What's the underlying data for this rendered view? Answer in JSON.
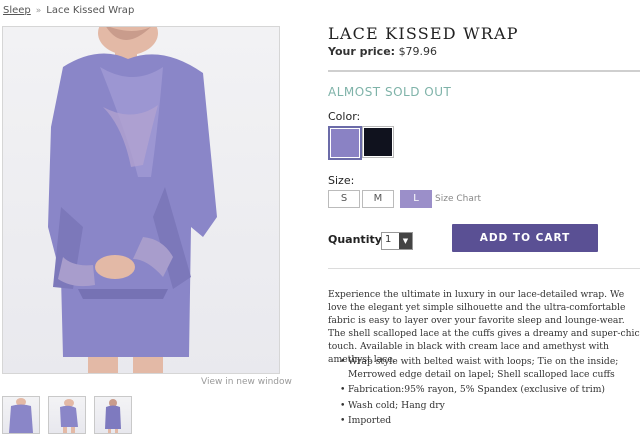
{
  "breadcrumb": {
    "link": "Sleep",
    "separator": "»",
    "current": "Lace Kissed Wrap"
  },
  "product": {
    "title": "LACE KISSED WRAP",
    "price_label": "Your price:",
    "price": "$79.96",
    "stock_status": "ALMOST SOLD OUT"
  },
  "gallery": {
    "view_new_window": "View in new window"
  },
  "options": {
    "color_label": "Color:",
    "colors": [
      {
        "name": "purple",
        "hex": "#8a82c4",
        "selected": true
      },
      {
        "name": "black",
        "hex": "#10121e",
        "selected": false
      }
    ],
    "size_label": "Size:",
    "sizes": [
      "S",
      "M",
      "L"
    ],
    "selected_size": "L",
    "size_chart": "Size Chart"
  },
  "purchase": {
    "quantity_label": "Quantity:",
    "quantity": "1",
    "add_to_cart": "ADD TO CART"
  },
  "description": "Experience the ultimate in luxury in our lace-detailed wrap. We love the elegant yet simple silhouette and the ultra-comfortable fabric is easy to layer over your favorite sleep and lounge-wear. The shell scalloped lace at the cuffs gives a dreamy and super-chic touch. Available in black with cream lace and amethyst with amethyst lace.",
  "features": [
    "Wrap style with belted waist with loops; Tie on the inside; Merrowed edge detail on lapel; Shell scalloped lace cuffs",
    "Fabrication:95% rayon, 5% Spandex (exclusive of trim)",
    "Wash cold; Hang dry",
    "Imported"
  ],
  "colors": {
    "accent": "#5a5094",
    "stock": "#7fb3a9",
    "robe": "#8a86c8"
  }
}
